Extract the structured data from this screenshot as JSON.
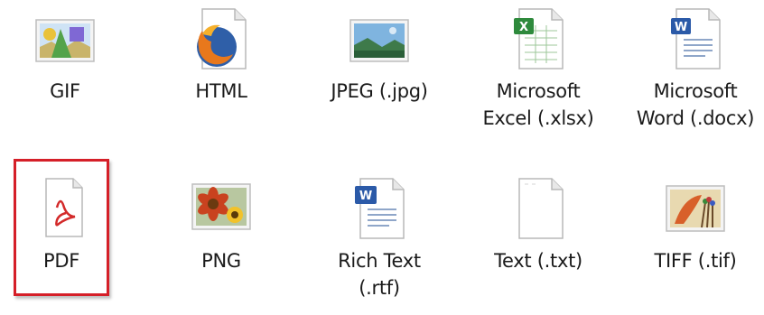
{
  "accent_color": "#d51f28",
  "files": [
    {
      "key": "gif",
      "label_lines": [
        "GIF"
      ],
      "icon": "gif-image-icon",
      "selected": false
    },
    {
      "key": "html",
      "label_lines": [
        "HTML"
      ],
      "icon": "firefox-document-icon",
      "selected": false
    },
    {
      "key": "jpeg",
      "label_lines": [
        "JPEG (.jpg)"
      ],
      "icon": "jpeg-image-icon",
      "selected": false
    },
    {
      "key": "xlsx",
      "label_lines": [
        "Microsoft",
        "Excel (.xlsx)"
      ],
      "icon": "excel-document-icon",
      "selected": false
    },
    {
      "key": "docx",
      "label_lines": [
        "Microsoft",
        "Word (.docx)"
      ],
      "icon": "word-document-icon",
      "selected": false
    },
    {
      "key": "pdf",
      "label_lines": [
        "PDF"
      ],
      "icon": "pdf-document-icon",
      "selected": true
    },
    {
      "key": "png",
      "label_lines": [
        "PNG"
      ],
      "icon": "png-image-icon",
      "selected": false
    },
    {
      "key": "rtf",
      "label_lines": [
        "Rich Text",
        "(.rtf)"
      ],
      "icon": "rtf-document-icon",
      "selected": false
    },
    {
      "key": "txt",
      "label_lines": [
        "Text (.txt)"
      ],
      "icon": "text-document-icon",
      "selected": false
    },
    {
      "key": "tiff",
      "label_lines": [
        "TIFF (.tif)"
      ],
      "icon": "tiff-image-icon",
      "selected": false
    }
  ]
}
